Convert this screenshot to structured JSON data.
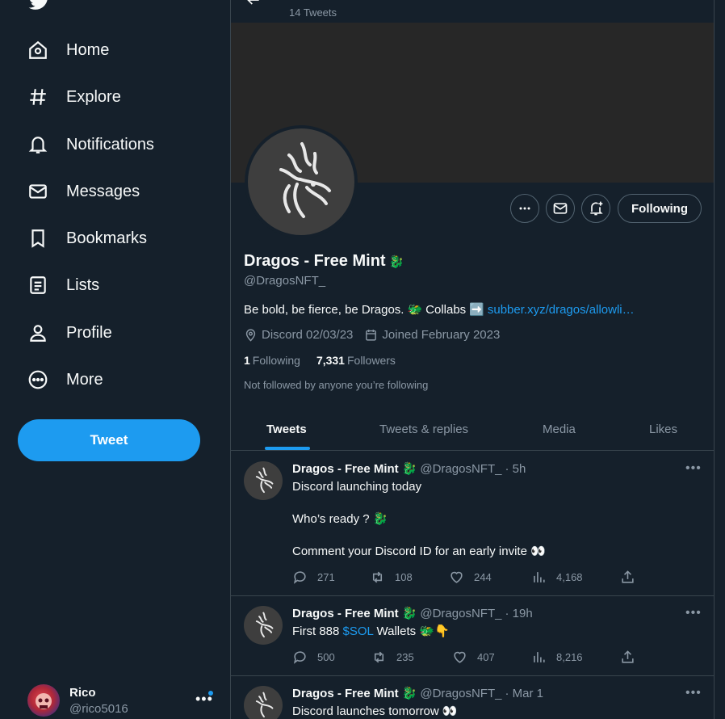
{
  "sidebar": {
    "nav": [
      {
        "label": "Home",
        "icon": "home-icon"
      },
      {
        "label": "Explore",
        "icon": "hashtag-icon"
      },
      {
        "label": "Notifications",
        "icon": "bell-icon"
      },
      {
        "label": "Messages",
        "icon": "envelope-icon"
      },
      {
        "label": "Bookmarks",
        "icon": "bookmark-icon"
      },
      {
        "label": "Lists",
        "icon": "list-icon"
      },
      {
        "label": "Profile",
        "icon": "person-icon"
      },
      {
        "label": "More",
        "icon": "more-circle-icon"
      }
    ],
    "tweet_button": "Tweet",
    "account": {
      "name": "Rico",
      "handle": "@rico5016"
    }
  },
  "header": {
    "tweet_count": "14 Tweets"
  },
  "profile": {
    "name": "Dragos - Free Mint",
    "name_emoji": "🐉",
    "handle": "@DragosNFT_",
    "bio_text": "Be bold, be fierce, be Dragos.",
    "bio_emoji_1": "🐲",
    "bio_collabs": "Collabs",
    "bio_arrow": "➡️",
    "bio_link": "subber.xyz/dragos/allowli…",
    "location": "Discord 02/03/23",
    "joined": "Joined February 2023",
    "following_count": "1",
    "following_label": "Following",
    "followers_count": "7,331",
    "followers_label": "Followers",
    "not_followed": "Not followed by anyone you’re following",
    "following_button": "Following"
  },
  "tabs": [
    "Tweets",
    "Tweets & replies",
    "Media",
    "Likes"
  ],
  "tweets": [
    {
      "name": "Dragos - Free Mint",
      "emoji": "🐉",
      "handle": "@DragosNFT_",
      "time": "· 5h",
      "line1": "Discord launching today",
      "line2": "Who’s ready ? 🐉",
      "line3": "Comment your Discord ID for an early invite 👀",
      "replies": "271",
      "retweets": "108",
      "likes": "244",
      "views": "4,168"
    },
    {
      "name": "Dragos - Free Mint",
      "emoji": "🐉",
      "handle": "@DragosNFT_",
      "time": "· 19h",
      "line1_pre": "First 888",
      "line1_cashtag": "$SOL",
      "line1_post": "Wallets 🐲👇",
      "replies": "500",
      "retweets": "235",
      "likes": "407",
      "views": "8,216"
    },
    {
      "name": "Dragos - Free Mint",
      "emoji": "🐉",
      "handle": "@DragosNFT_",
      "time": "· Mar 1",
      "line1": "Discord launches tomorrow 👀"
    }
  ],
  "colors": {
    "background": "#15202b",
    "accent": "#1d9bf0",
    "muted": "#8b98a5",
    "border": "#38444d"
  }
}
